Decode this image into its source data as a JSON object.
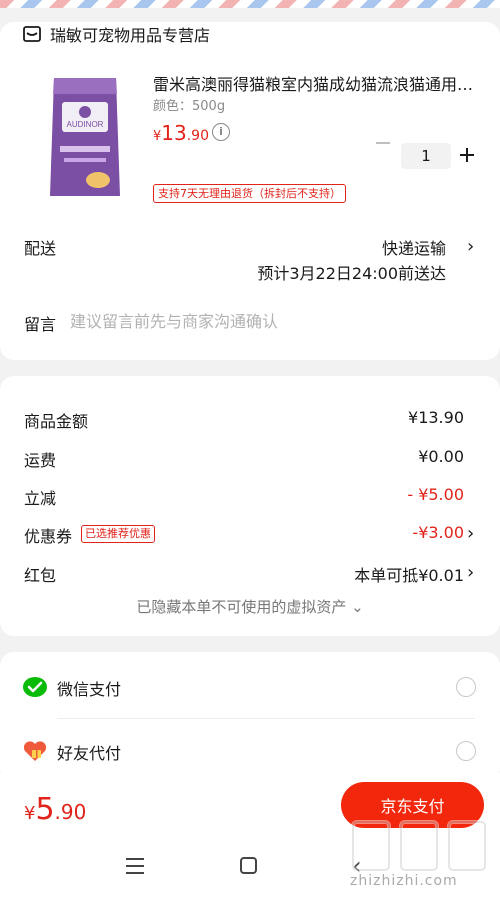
{
  "store": {
    "name": "瑞敏可宠物用品专营店"
  },
  "product": {
    "title": "雷米高澳丽得猫粮室内猫成幼猫流浪猫通用…",
    "spec": "颜色：500g",
    "price_symbol": "¥",
    "price_int": "13",
    "price_dec": ".90",
    "quantity": "1",
    "return_policy": "支持7天无理由退货（拆封后不支持）",
    "package_brand": "AUDINOR"
  },
  "shipping": {
    "label": "配送",
    "method": "快递运输",
    "eta": "预计3月22日24:00前送达"
  },
  "note": {
    "label": "留言",
    "placeholder": "建议留言前先与商家沟通确认"
  },
  "summary": {
    "rows": [
      {
        "label": "商品金额",
        "value": "¥13.90"
      },
      {
        "label": "运费",
        "value": "¥0.00"
      },
      {
        "label": "立减",
        "value": "- ¥5.00"
      },
      {
        "label": "优惠券",
        "tag": "已选推荐优惠",
        "value": "-¥3.00"
      },
      {
        "label": "红包",
        "value": "本单可抵¥0.01"
      }
    ],
    "hidden_assets": "已隐藏本单不可使用的虚拟资产 ⌄"
  },
  "payment": {
    "methods": [
      {
        "name": "微信支付",
        "icon": "wechat-pay-icon"
      },
      {
        "name": "好友代付",
        "icon": "friend-pay-icon"
      }
    ]
  },
  "footer": {
    "total_symbol": "¥",
    "total_int": "5",
    "total_dec": ".90",
    "pay_button": "京东支付"
  },
  "watermark": {
    "text": "zhizhizhi.com"
  },
  "colors": {
    "accent": "#e2231a",
    "pay_button": "#f2270c",
    "wechat": "#09bb07"
  }
}
